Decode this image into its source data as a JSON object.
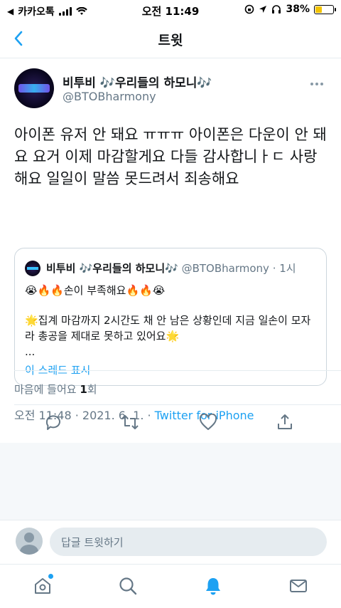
{
  "status_bar": {
    "carrier": "카카오톡",
    "time": "오전 11:49",
    "battery": "38%",
    "battery_level": 0.38
  },
  "nav": {
    "title": "트윗"
  },
  "tweet": {
    "author_name": "비투비 🎶우리들의 하모니🎶",
    "author_handle": "@BTOBharmony",
    "text": "아이폰 유저 안 돼요 ㅠㅠㅠ 아이폰은 다운이 안 돼요 요거 이제 마감할게요 다들 감사합니ㅏㄷ 사랑해요 일일이 말씀 못드려서 죄송해요",
    "timestamp": "오전 11:48 · 2021. 6. 1. · ",
    "client": "Twitter for iPhone",
    "likes_label": "마음에 들어요 ",
    "likes_count": "1",
    "likes_suffix": "회"
  },
  "quoted": {
    "author_name": "비투비 🎶우리들의 하모니🎶",
    "author_handle": "@BTOBharmony",
    "time": "1시",
    "line1": "😭🔥🔥손이 부족해요🔥🔥😭",
    "body": "🌟집계 마감까지 2시간도 채 안 남은 상황인데 지금 일손이 모자라 총공을 제대로 못하고 있어요🌟\n...",
    "thread_link": "이 스레드 표시"
  },
  "reply": {
    "placeholder": "답글 트윗하기"
  },
  "colors": {
    "accent": "#1da1f2",
    "secondary_text": "#657786"
  }
}
